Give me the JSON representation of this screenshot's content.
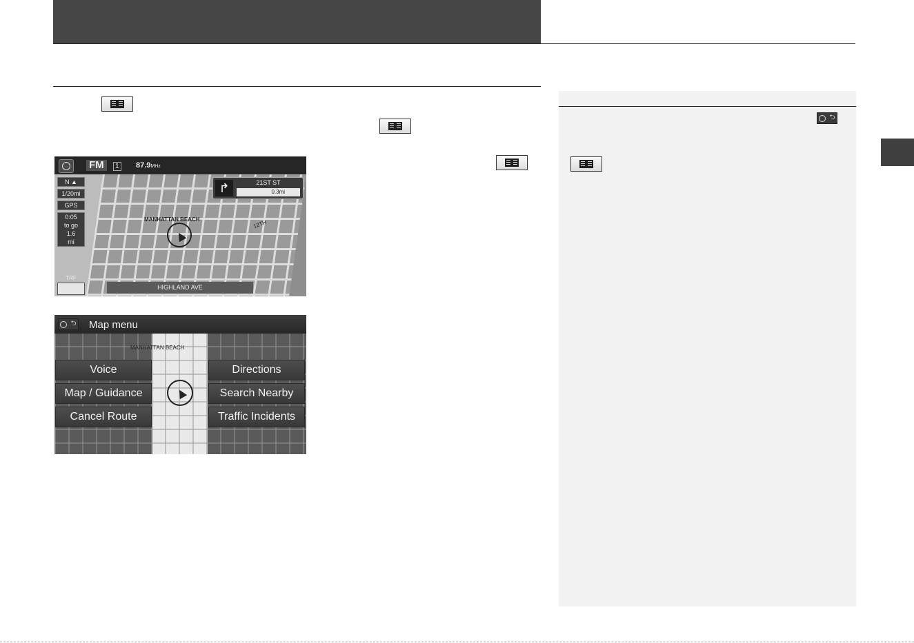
{
  "nav_screen": {
    "radio": {
      "band": "FM",
      "preset": "1",
      "frequency": "87.9",
      "frequency_unit": "MHz"
    },
    "north_label": "N",
    "scale": "1/20",
    "scale_unit": "mi",
    "gps_label": "GPS",
    "time_to_go": "0:05",
    "to_go_label": "to go",
    "distance_to_go": "1.6",
    "distance_unit": "mi",
    "next_street": "21ST ST",
    "next_distance": "0.3mi",
    "place_label": "MANHATTAN BEACH",
    "street_12th": "12TH",
    "traffic_label": "TRF",
    "current_road": "HIGHLAND AVE"
  },
  "map_menu_screen": {
    "title": "Map menu",
    "place_label": "MANHATTAN BEACH",
    "buttons": {
      "voice": "Voice",
      "directions": "Directions",
      "map_guidance": "Map / Guidance",
      "search_nearby": "Search Nearby",
      "cancel_route": "Cancel Route",
      "traffic_incidents": "Traffic Incidents"
    }
  },
  "icons": {
    "map_menu_button": "map-menu-icon",
    "home_back_button": "home-back-icon"
  }
}
